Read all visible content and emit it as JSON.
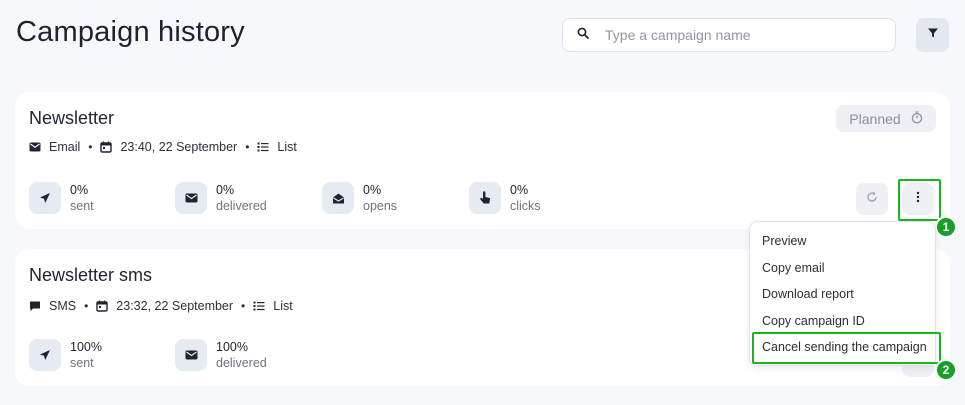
{
  "page": {
    "title": "Campaign history"
  },
  "search": {
    "placeholder": "Type a campaign name",
    "icon": "search-icon"
  },
  "filter": {
    "icon": "filter-icon"
  },
  "campaigns": [
    {
      "name": "Newsletter",
      "channel": "Email",
      "datetime": "23:40, 22 September",
      "audience": "List",
      "status": "Planned",
      "stats": [
        {
          "value": "0%",
          "label": "sent",
          "icon": "send-icon"
        },
        {
          "value": "0%",
          "label": "delivered",
          "icon": "envelope-icon"
        },
        {
          "value": "0%",
          "label": "opens",
          "icon": "open-envelope-icon"
        },
        {
          "value": "0%",
          "label": "clicks",
          "icon": "pointer-icon"
        }
      ]
    },
    {
      "name": "Newsletter sms",
      "channel": "SMS",
      "datetime": "23:32, 22 September",
      "audience": "List",
      "stats": [
        {
          "value": "100%",
          "label": "sent",
          "icon": "send-icon"
        },
        {
          "value": "100%",
          "label": "delivered",
          "icon": "envelope-icon"
        }
      ]
    }
  ],
  "menu": {
    "items": [
      "Preview",
      "Copy email",
      "Download report",
      "Copy campaign ID",
      "Cancel sending the campaign"
    ]
  },
  "annotations": {
    "badge1": "1",
    "badge2": "2",
    "color": "#1bb51b"
  }
}
